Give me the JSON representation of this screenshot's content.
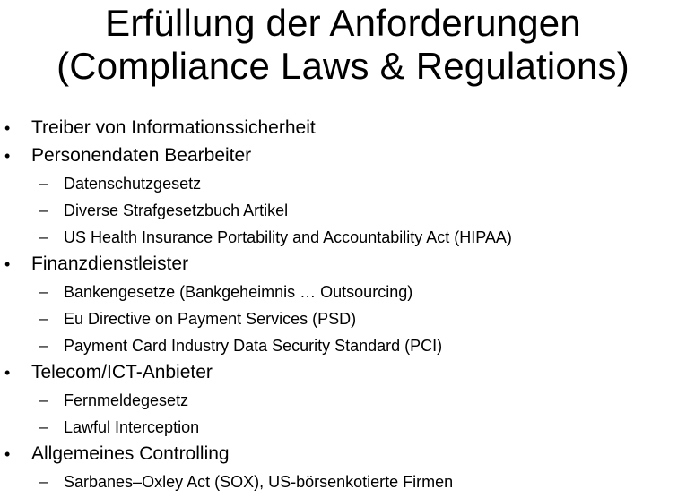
{
  "slide": {
    "title_lines": [
      "Erfüllung der Anforderungen",
      "(Compliance Laws & Regulations)"
    ],
    "items": [
      {
        "level": 1,
        "marker": "•",
        "text": "Treiber von Informationssicherheit"
      },
      {
        "level": 1,
        "marker": "•",
        "text": "Personendaten Bearbeiter"
      },
      {
        "level": 2,
        "marker": "–",
        "text": "Datenschutzgesetz"
      },
      {
        "level": 2,
        "marker": "–",
        "text": "Diverse Strafgesetzbuch Artikel"
      },
      {
        "level": 2,
        "marker": "–",
        "text": "US Health Insurance Portability and Accountability Act (HIPAA)"
      },
      {
        "level": 1,
        "marker": "•",
        "text": "Finanzdienstleister"
      },
      {
        "level": 2,
        "marker": "–",
        "text": "Bankengesetze (Bankgeheimnis … Outsourcing)"
      },
      {
        "level": 2,
        "marker": "–",
        "text": "Eu Directive on Payment Services (PSD)"
      },
      {
        "level": 2,
        "marker": "–",
        "text": "Payment Card Industry Data Security Standard (PCI)"
      },
      {
        "level": 1,
        "marker": "•",
        "text": "Telecom/ICT-Anbieter"
      },
      {
        "level": 2,
        "marker": "–",
        "text": "Fernmeldegesetz"
      },
      {
        "level": 2,
        "marker": "–",
        "text": "Lawful Interception"
      },
      {
        "level": 1,
        "marker": "•",
        "text": "Allgemeines Controlling"
      },
      {
        "level": 2,
        "marker": "–",
        "text": "Sarbanes–Oxley Act (SOX), US-börsenkotierte Firmen"
      }
    ]
  }
}
